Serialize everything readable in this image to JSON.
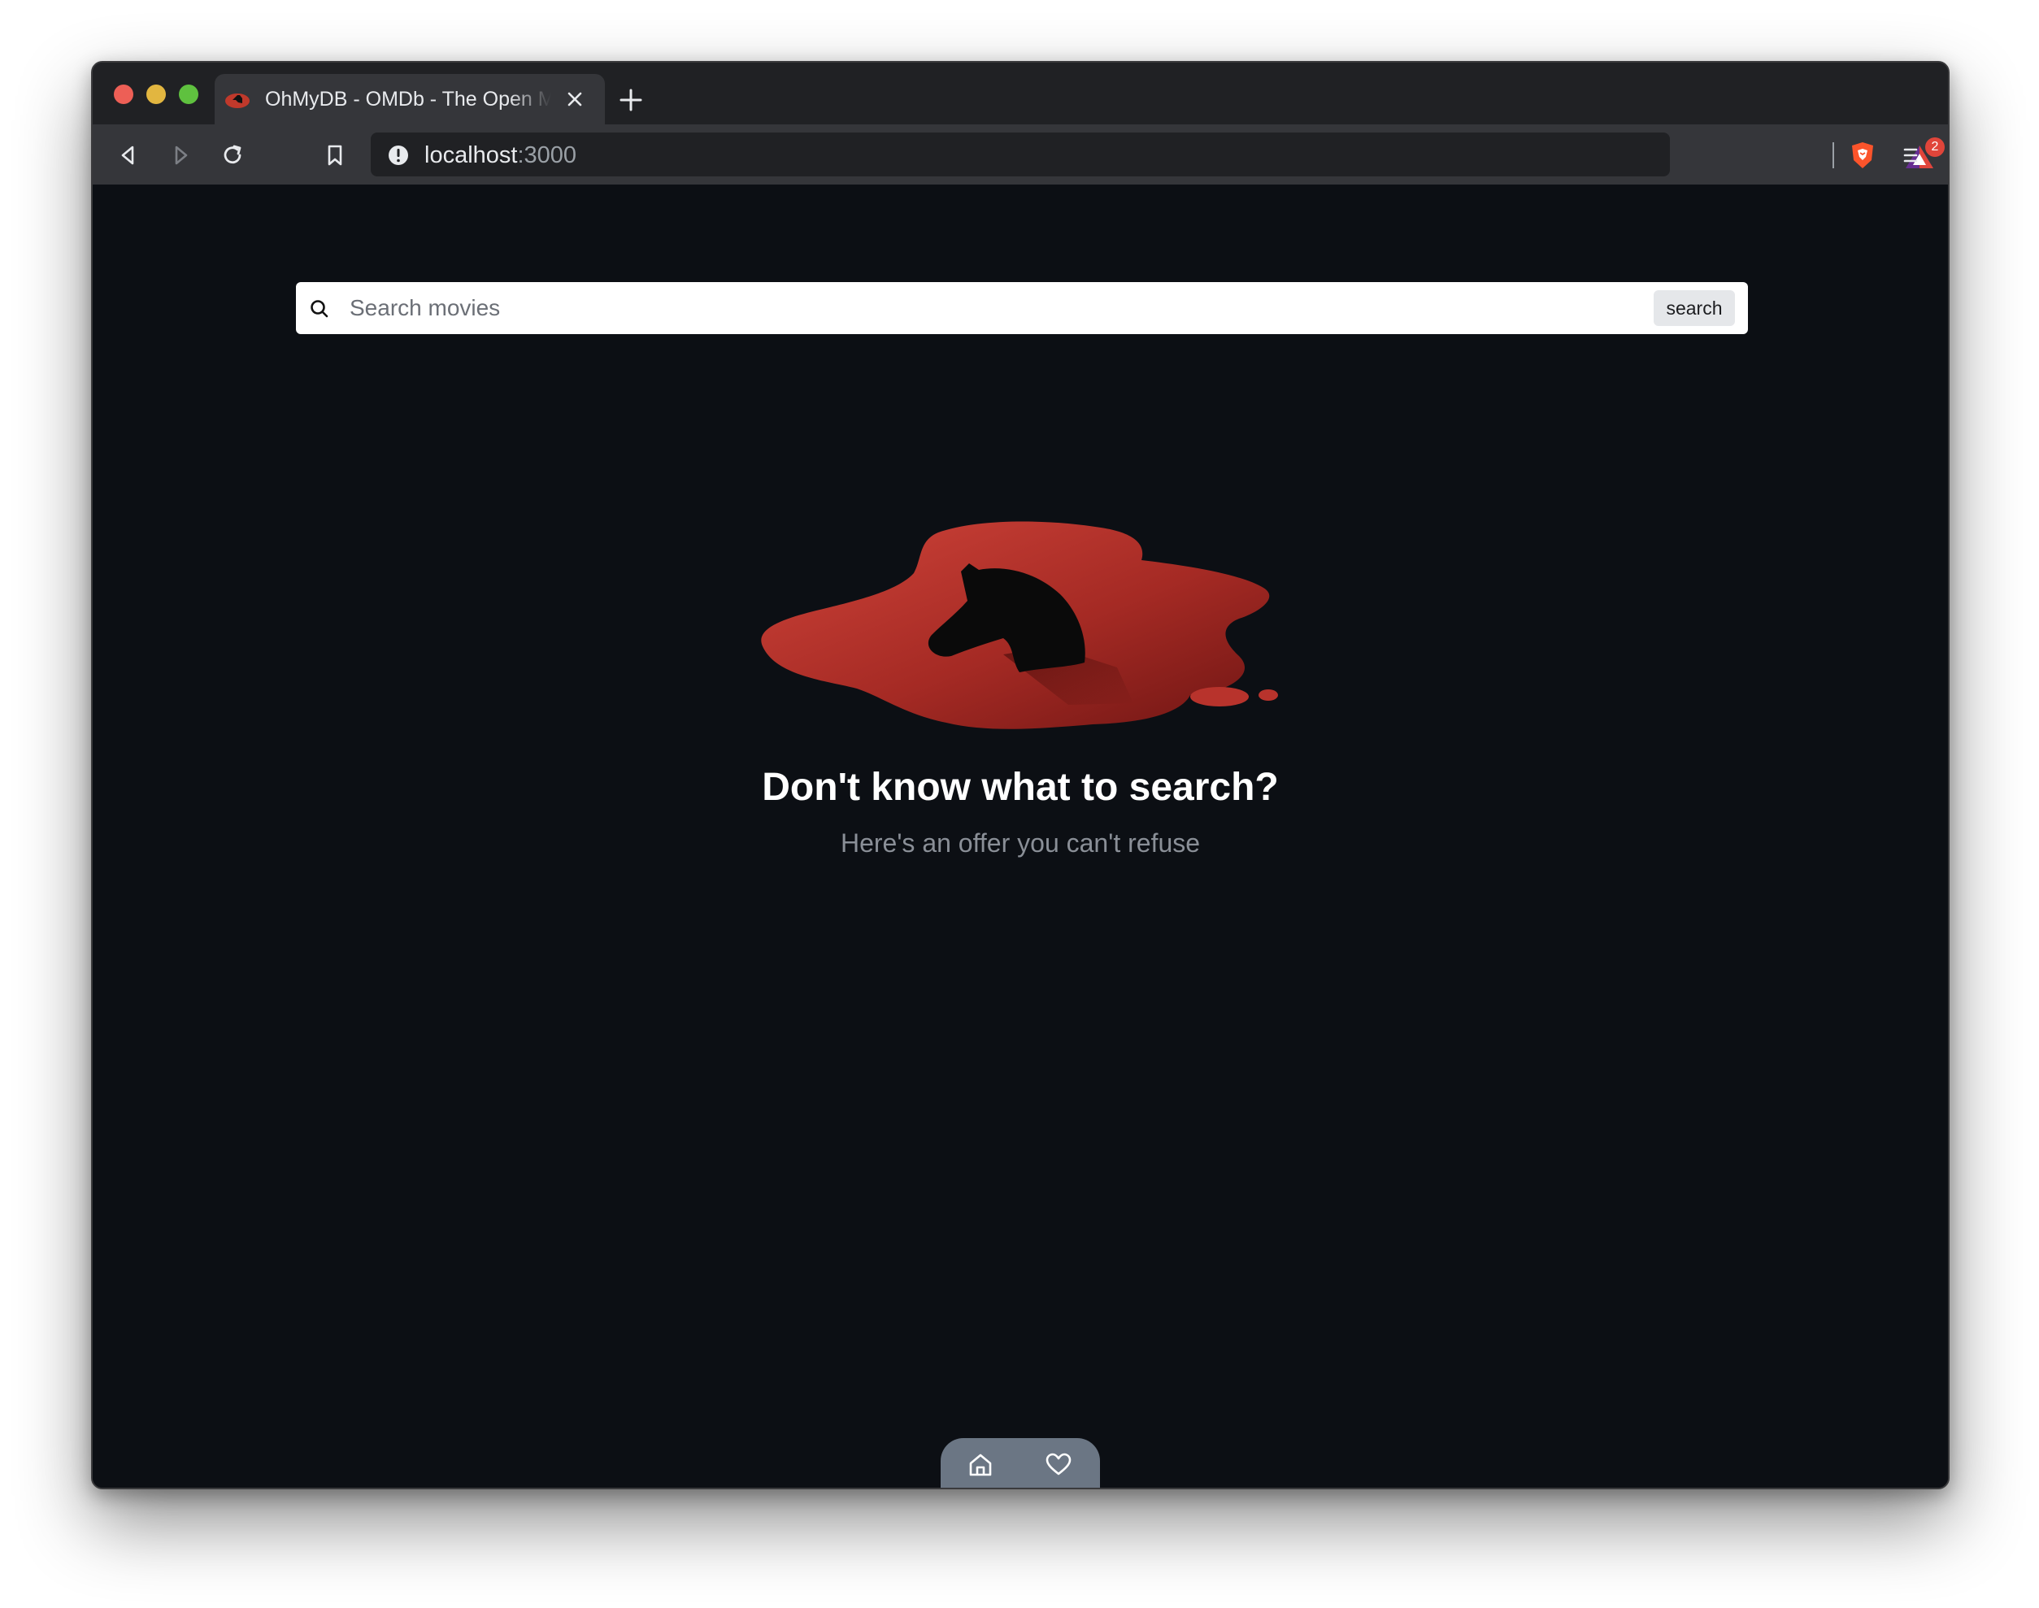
{
  "browser": {
    "tab": {
      "title": "OhMyDB - OMDb - The Open Movie Database",
      "favicon": "horse-blood-icon"
    },
    "url": {
      "host": "localhost",
      "port": ":3000"
    },
    "rewards_badge_count": "2",
    "icons": [
      "back-icon",
      "forward-icon",
      "reload-icon",
      "bookmark-icon",
      "info-icon",
      "brave-shield-icon",
      "brave-rewards-icon",
      "menu-icon"
    ]
  },
  "search": {
    "placeholder": "Search movies",
    "value": "",
    "button_label": "search"
  },
  "empty_state": {
    "title": "Don't know what to search?",
    "subtitle": "Here's an offer you can't refuse"
  },
  "bottom_nav": {
    "items": [
      "home-icon",
      "heart-icon"
    ]
  },
  "colors": {
    "page_background": "#0c0f14",
    "browser_chrome": "#35363a",
    "blood_red": "#c0392b",
    "nav_background": "#6b7684"
  }
}
